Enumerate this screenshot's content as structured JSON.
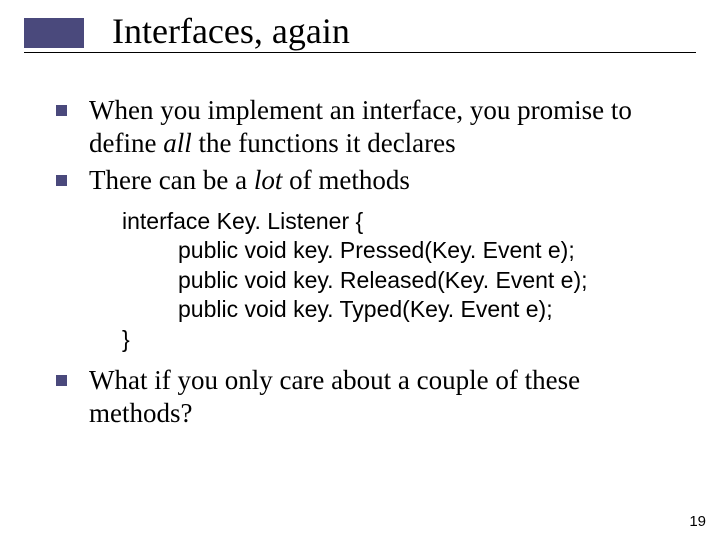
{
  "title": "Interfaces, again",
  "bullets": {
    "b1_pre": "When you implement an interface, you promise to define ",
    "b1_ital": "all",
    "b1_post": " the functions it declares",
    "b2_pre": "There can be a ",
    "b2_ital": "lot",
    "b2_post": " of methods",
    "b3": "What if you only care about a couple of these methods?"
  },
  "code": {
    "l1": "interface Key. Listener {",
    "l2": "public void key. Pressed(Key. Event e);",
    "l3": "public void key. Released(Key. Event e);",
    "l4": "public void key. Typed(Key. Event e);",
    "l5": "}"
  },
  "page_number": "19"
}
